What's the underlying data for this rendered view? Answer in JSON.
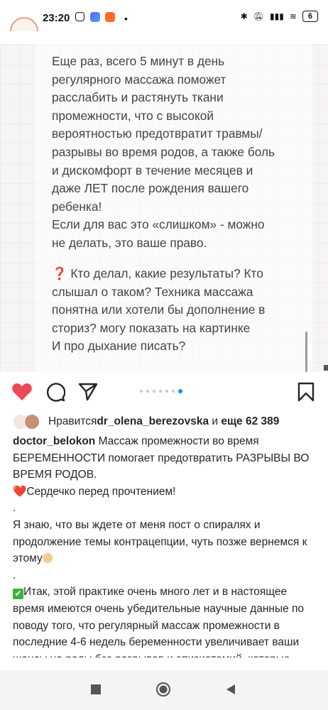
{
  "status": {
    "time": "23:20",
    "battery": "6"
  },
  "post_image": {
    "text": "Еще раз, всего 5 минут в день\nрегулярного массажа поможет\nрасслабить и растянуть ткани\nпромежности, что с высокой\nвероятностью предотвратит травмы/\nразрывы во время родов, а также боль\nи дискомфорт в течение месяцев и\nдаже ЛЕТ после рождения вашего\nребенка!\nЕсли для вас это «слишком» - можно\nне делать, это ваше право.",
    "question_mark": "❓",
    "question": " Кто делал, какие результаты? Кто\nслышал о таком? Техника массажа\nпонятна или хотели бы дополнение в\nсториз? могу показать на картинке\nИ про дыхание писать?"
  },
  "carousel": {
    "count": 7,
    "active_index": 6
  },
  "likes": {
    "prefix": "Нравится ",
    "user": "dr_olena_berezovska",
    "middle": " и ",
    "count": "еще 62 389"
  },
  "caption": {
    "username": "doctor_belokon",
    "line1": " Массаж промежности во время БЕРЕМЕННОСТИ помогает предотвратить РАЗРЫВЫ ВО ВРЕМЯ РОДОВ.",
    "heart": "❤️",
    "line2": "Сердечко перед прочтением!",
    "dot1": ".",
    "line3": "Я знаю, что вы ждете от меня пост о спиралях и продолжение темы контрацепции, чуть позже вернемся к этому",
    "dot2": ".",
    "check": "✔",
    "line4": "Итак, этой практике очень много лет и в настоящее время имеются очень убедительные научные данные по поводу того, что регулярный массаж промежности в последние 4-6 недель беременности увеличивает ваши шансы на роды без разрывов и эпизиотомий, которые могут в последствии привести к проблемам"
  },
  "colors": {
    "like_red": "#ed4956",
    "accent_blue": "#0095f6"
  },
  "icons": [
    "heart-icon",
    "comment-icon",
    "share-icon",
    "bookmark-icon",
    "nav-recent-icon",
    "nav-home-icon",
    "nav-back-icon"
  ]
}
